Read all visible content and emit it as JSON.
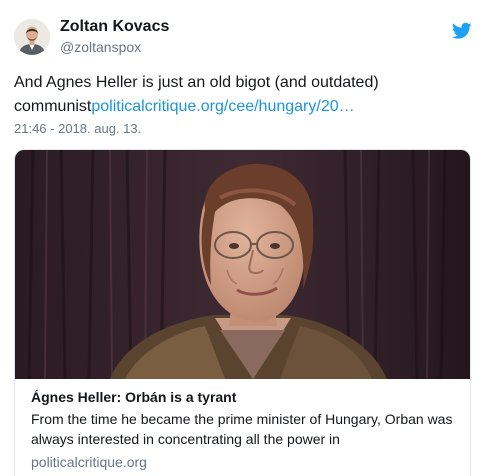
{
  "author": {
    "name": "Zoltan Kovacs",
    "handle": "@zoltanspox"
  },
  "tweet": {
    "text": "And Agnes Heller is just an old bigot (and outdated) communist",
    "link_text": "politicalcritique.org/cee/hungary/20…",
    "timestamp": "21:46 - 2018. aug. 13."
  },
  "card": {
    "title": "Ágnes Heller: Orbán is a tyrant",
    "description": "From the time he became the prime minister of Hungary, Orban was always interested in concentrating all the power in",
    "domain": "politicalcritique.org"
  },
  "colors": {
    "link": "#1b95e0",
    "twitter_blue": "#1da1f2",
    "secondary_text": "#657786",
    "border": "#e1e8ed"
  },
  "icons": {
    "brand": "twitter-bird-icon"
  }
}
